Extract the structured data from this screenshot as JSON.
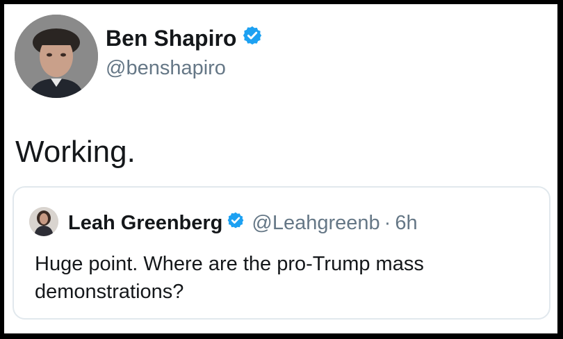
{
  "tweet": {
    "author_name": "Ben Shapiro",
    "author_handle": "@benshapiro",
    "text": "Working.",
    "avatar_icon": "person-photo-avatar",
    "verified_icon": "verified-badge-icon"
  },
  "quoted_tweet": {
    "author_name": "Leah Greenberg",
    "author_handle": "@Leahgreenb",
    "separator": "·",
    "time": "6h",
    "text_line1": "Huge point. Where are the pro-Trump mass",
    "text_line2": "demonstrations?",
    "avatar_icon": "person-photo-avatar",
    "verified_icon": "verified-badge-icon"
  },
  "colors": {
    "verified_blue": "#1da1f2",
    "text_primary": "#14171a",
    "text_secondary": "#657786",
    "quote_border": "#e1e8ed",
    "frame_border": "#000000"
  }
}
